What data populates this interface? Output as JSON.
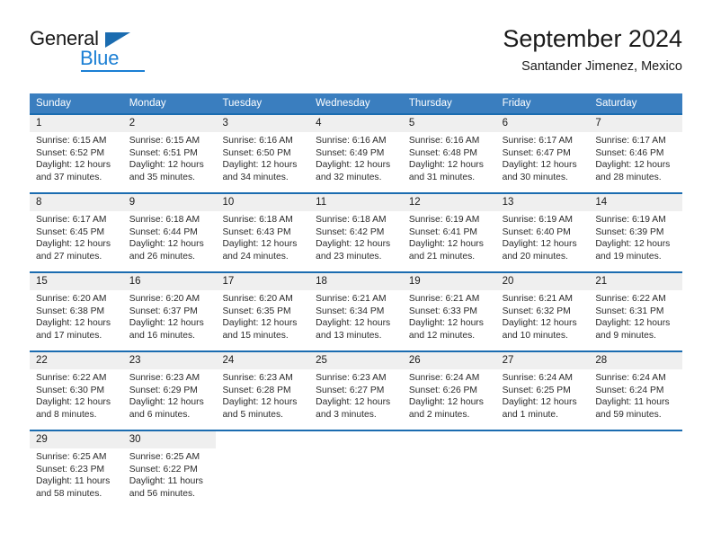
{
  "brand": {
    "name_top": "General",
    "name_bottom": "Blue",
    "accent_color": "#1b7fd4",
    "flag_color": "#1b6cb0"
  },
  "header": {
    "title": "September 2024",
    "location": "Santander Jimenez, Mexico"
  },
  "theme": {
    "header_band": "#3a7ebf",
    "row_divider": "#1b6cb0",
    "day_band": "#efefef",
    "text": "#1a1a1a"
  },
  "weekdays": [
    "Sunday",
    "Monday",
    "Tuesday",
    "Wednesday",
    "Thursday",
    "Friday",
    "Saturday"
  ],
  "weeks": [
    [
      {
        "day": "1",
        "sunrise": "Sunrise: 6:15 AM",
        "sunset": "Sunset: 6:52 PM",
        "daylight1": "Daylight: 12 hours",
        "daylight2": "and 37 minutes."
      },
      {
        "day": "2",
        "sunrise": "Sunrise: 6:15 AM",
        "sunset": "Sunset: 6:51 PM",
        "daylight1": "Daylight: 12 hours",
        "daylight2": "and 35 minutes."
      },
      {
        "day": "3",
        "sunrise": "Sunrise: 6:16 AM",
        "sunset": "Sunset: 6:50 PM",
        "daylight1": "Daylight: 12 hours",
        "daylight2": "and 34 minutes."
      },
      {
        "day": "4",
        "sunrise": "Sunrise: 6:16 AM",
        "sunset": "Sunset: 6:49 PM",
        "daylight1": "Daylight: 12 hours",
        "daylight2": "and 32 minutes."
      },
      {
        "day": "5",
        "sunrise": "Sunrise: 6:16 AM",
        "sunset": "Sunset: 6:48 PM",
        "daylight1": "Daylight: 12 hours",
        "daylight2": "and 31 minutes."
      },
      {
        "day": "6",
        "sunrise": "Sunrise: 6:17 AM",
        "sunset": "Sunset: 6:47 PM",
        "daylight1": "Daylight: 12 hours",
        "daylight2": "and 30 minutes."
      },
      {
        "day": "7",
        "sunrise": "Sunrise: 6:17 AM",
        "sunset": "Sunset: 6:46 PM",
        "daylight1": "Daylight: 12 hours",
        "daylight2": "and 28 minutes."
      }
    ],
    [
      {
        "day": "8",
        "sunrise": "Sunrise: 6:17 AM",
        "sunset": "Sunset: 6:45 PM",
        "daylight1": "Daylight: 12 hours",
        "daylight2": "and 27 minutes."
      },
      {
        "day": "9",
        "sunrise": "Sunrise: 6:18 AM",
        "sunset": "Sunset: 6:44 PM",
        "daylight1": "Daylight: 12 hours",
        "daylight2": "and 26 minutes."
      },
      {
        "day": "10",
        "sunrise": "Sunrise: 6:18 AM",
        "sunset": "Sunset: 6:43 PM",
        "daylight1": "Daylight: 12 hours",
        "daylight2": "and 24 minutes."
      },
      {
        "day": "11",
        "sunrise": "Sunrise: 6:18 AM",
        "sunset": "Sunset: 6:42 PM",
        "daylight1": "Daylight: 12 hours",
        "daylight2": "and 23 minutes."
      },
      {
        "day": "12",
        "sunrise": "Sunrise: 6:19 AM",
        "sunset": "Sunset: 6:41 PM",
        "daylight1": "Daylight: 12 hours",
        "daylight2": "and 21 minutes."
      },
      {
        "day": "13",
        "sunrise": "Sunrise: 6:19 AM",
        "sunset": "Sunset: 6:40 PM",
        "daylight1": "Daylight: 12 hours",
        "daylight2": "and 20 minutes."
      },
      {
        "day": "14",
        "sunrise": "Sunrise: 6:19 AM",
        "sunset": "Sunset: 6:39 PM",
        "daylight1": "Daylight: 12 hours",
        "daylight2": "and 19 minutes."
      }
    ],
    [
      {
        "day": "15",
        "sunrise": "Sunrise: 6:20 AM",
        "sunset": "Sunset: 6:38 PM",
        "daylight1": "Daylight: 12 hours",
        "daylight2": "and 17 minutes."
      },
      {
        "day": "16",
        "sunrise": "Sunrise: 6:20 AM",
        "sunset": "Sunset: 6:37 PM",
        "daylight1": "Daylight: 12 hours",
        "daylight2": "and 16 minutes."
      },
      {
        "day": "17",
        "sunrise": "Sunrise: 6:20 AM",
        "sunset": "Sunset: 6:35 PM",
        "daylight1": "Daylight: 12 hours",
        "daylight2": "and 15 minutes."
      },
      {
        "day": "18",
        "sunrise": "Sunrise: 6:21 AM",
        "sunset": "Sunset: 6:34 PM",
        "daylight1": "Daylight: 12 hours",
        "daylight2": "and 13 minutes."
      },
      {
        "day": "19",
        "sunrise": "Sunrise: 6:21 AM",
        "sunset": "Sunset: 6:33 PM",
        "daylight1": "Daylight: 12 hours",
        "daylight2": "and 12 minutes."
      },
      {
        "day": "20",
        "sunrise": "Sunrise: 6:21 AM",
        "sunset": "Sunset: 6:32 PM",
        "daylight1": "Daylight: 12 hours",
        "daylight2": "and 10 minutes."
      },
      {
        "day": "21",
        "sunrise": "Sunrise: 6:22 AM",
        "sunset": "Sunset: 6:31 PM",
        "daylight1": "Daylight: 12 hours",
        "daylight2": "and 9 minutes."
      }
    ],
    [
      {
        "day": "22",
        "sunrise": "Sunrise: 6:22 AM",
        "sunset": "Sunset: 6:30 PM",
        "daylight1": "Daylight: 12 hours",
        "daylight2": "and 8 minutes."
      },
      {
        "day": "23",
        "sunrise": "Sunrise: 6:23 AM",
        "sunset": "Sunset: 6:29 PM",
        "daylight1": "Daylight: 12 hours",
        "daylight2": "and 6 minutes."
      },
      {
        "day": "24",
        "sunrise": "Sunrise: 6:23 AM",
        "sunset": "Sunset: 6:28 PM",
        "daylight1": "Daylight: 12 hours",
        "daylight2": "and 5 minutes."
      },
      {
        "day": "25",
        "sunrise": "Sunrise: 6:23 AM",
        "sunset": "Sunset: 6:27 PM",
        "daylight1": "Daylight: 12 hours",
        "daylight2": "and 3 minutes."
      },
      {
        "day": "26",
        "sunrise": "Sunrise: 6:24 AM",
        "sunset": "Sunset: 6:26 PM",
        "daylight1": "Daylight: 12 hours",
        "daylight2": "and 2 minutes."
      },
      {
        "day": "27",
        "sunrise": "Sunrise: 6:24 AM",
        "sunset": "Sunset: 6:25 PM",
        "daylight1": "Daylight: 12 hours",
        "daylight2": "and 1 minute."
      },
      {
        "day": "28",
        "sunrise": "Sunrise: 6:24 AM",
        "sunset": "Sunset: 6:24 PM",
        "daylight1": "Daylight: 11 hours",
        "daylight2": "and 59 minutes."
      }
    ],
    [
      {
        "day": "29",
        "sunrise": "Sunrise: 6:25 AM",
        "sunset": "Sunset: 6:23 PM",
        "daylight1": "Daylight: 11 hours",
        "daylight2": "and 58 minutes."
      },
      {
        "day": "30",
        "sunrise": "Sunrise: 6:25 AM",
        "sunset": "Sunset: 6:22 PM",
        "daylight1": "Daylight: 11 hours",
        "daylight2": "and 56 minutes."
      },
      {
        "day": "",
        "sunrise": "",
        "sunset": "",
        "daylight1": "",
        "daylight2": ""
      },
      {
        "day": "",
        "sunrise": "",
        "sunset": "",
        "daylight1": "",
        "daylight2": ""
      },
      {
        "day": "",
        "sunrise": "",
        "sunset": "",
        "daylight1": "",
        "daylight2": ""
      },
      {
        "day": "",
        "sunrise": "",
        "sunset": "",
        "daylight1": "",
        "daylight2": ""
      },
      {
        "day": "",
        "sunrise": "",
        "sunset": "",
        "daylight1": "",
        "daylight2": ""
      }
    ]
  ]
}
